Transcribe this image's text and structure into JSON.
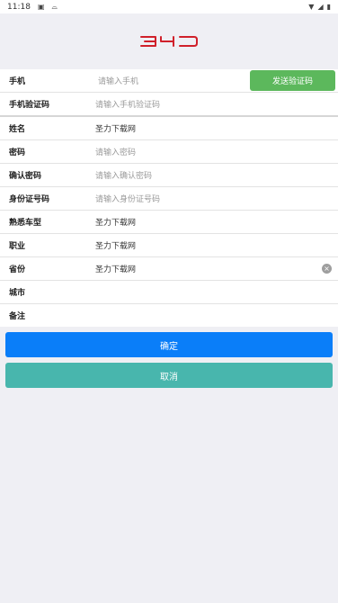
{
  "status_bar": {
    "time": "11:18"
  },
  "brand": {
    "accent_color": "#d0202a"
  },
  "form": {
    "phone": {
      "label": "手机",
      "placeholder": "请输入手机",
      "send_code_label": "发送验证码"
    },
    "sms_code": {
      "label": "手机验证码",
      "placeholder": "请输入手机验证码"
    },
    "name": {
      "label": "姓名",
      "value": "圣力下载网"
    },
    "password": {
      "label": "密码",
      "placeholder": "请输入密码"
    },
    "confirm_password": {
      "label": "确认密码",
      "placeholder": "请输入确认密码"
    },
    "id_number": {
      "label": "身份证号码",
      "placeholder": "请输入身份证号码"
    },
    "car_model": {
      "label": "熟悉车型",
      "value": "圣力下载网"
    },
    "occupation": {
      "label": "职业",
      "value": "圣力下载网"
    },
    "province": {
      "label": "省份",
      "value": "圣力下载网"
    },
    "city": {
      "label": "城市",
      "value": ""
    },
    "remark": {
      "label": "备注",
      "value": ""
    }
  },
  "actions": {
    "confirm_label": "确定",
    "cancel_label": "取消",
    "confirm_color": "#0a7ef9",
    "cancel_color": "#48b6ad",
    "send_code_color": "#5cb85c"
  }
}
